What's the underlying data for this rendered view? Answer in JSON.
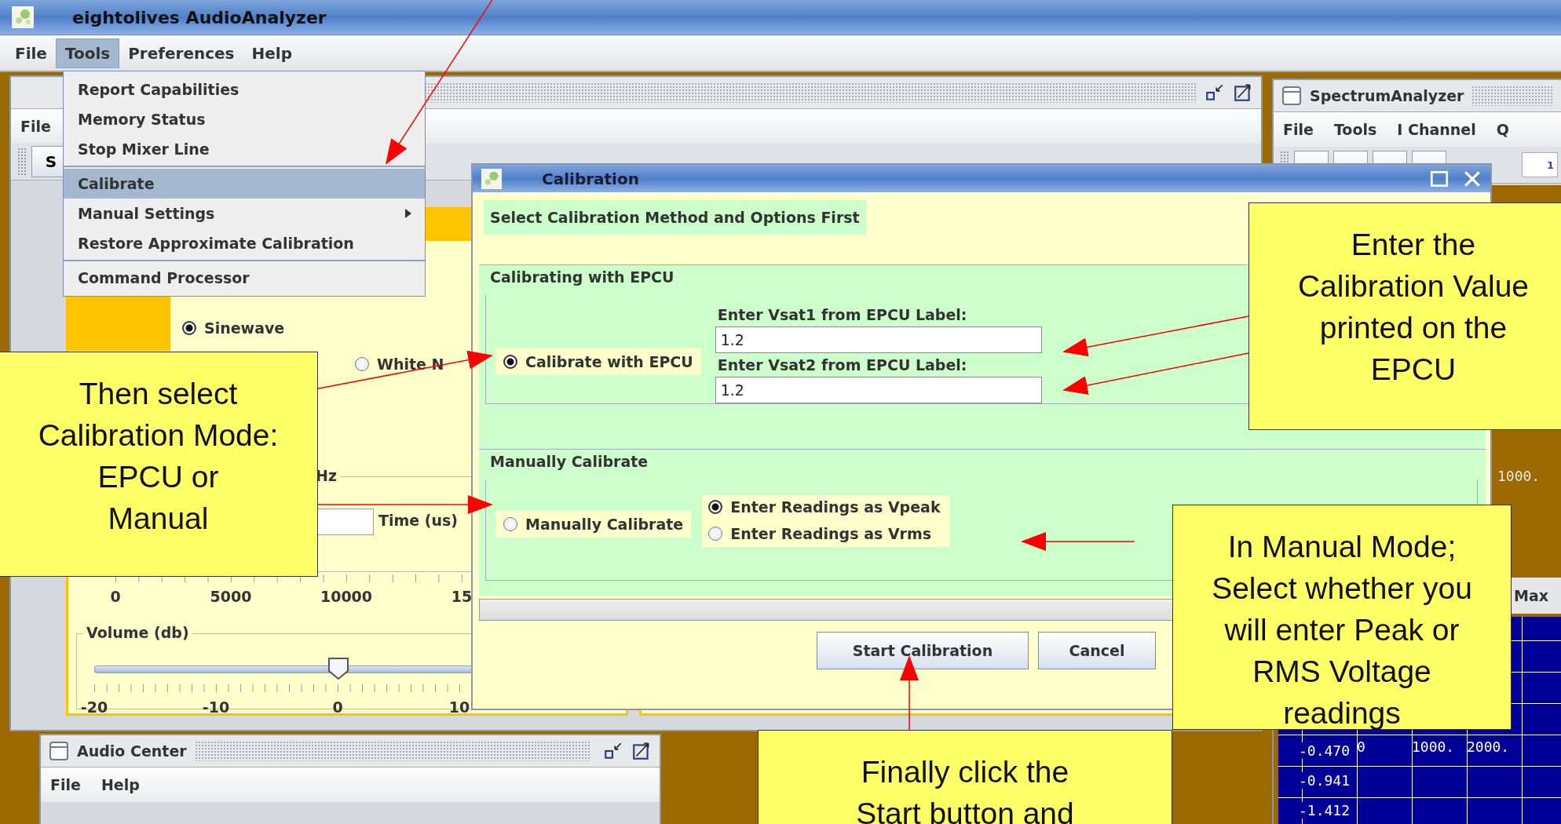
{
  "window": {
    "title": "eightolives AudioAnalyzer"
  },
  "menu_bar": [
    {
      "label": "File",
      "selected": false
    },
    {
      "label": "Tools",
      "selected": true
    },
    {
      "label": "Preferences",
      "selected": false
    },
    {
      "label": "Help",
      "selected": false
    }
  ],
  "tools_menu": {
    "groups": [
      [
        {
          "label": "Report Capabilities",
          "selected": false,
          "submenu": false
        },
        {
          "label": "Memory Status",
          "selected": false,
          "submenu": false
        },
        {
          "label": "Stop Mixer Line",
          "selected": false,
          "submenu": false
        }
      ],
      [
        {
          "label": "Calibrate",
          "selected": true,
          "submenu": false
        },
        {
          "label": "Manual Settings",
          "selected": false,
          "submenu": true
        },
        {
          "label": "Restore Approximate Calibration",
          "selected": false,
          "submenu": false
        }
      ],
      [
        {
          "label": "Command Processor",
          "selected": false,
          "submenu": false
        }
      ]
    ]
  },
  "generator_window": {
    "menu": [
      "File"
    ],
    "toolbar_button": "S",
    "waveforms": [
      {
        "label": "Sinewave",
        "selected": true
      },
      {
        "label": "White N",
        "selected": false
      }
    ],
    "frequency_unit": "Hz",
    "time_label": "Time (us)",
    "frequency_ticks": [
      "0",
      "5000",
      "10000",
      "15"
    ],
    "volume": {
      "title": "Volume (db)",
      "level": 0.5,
      "ticks": [
        "-20",
        "-10",
        "0",
        "10"
      ]
    }
  },
  "audio_center": {
    "title": "Audio Center",
    "menu": [
      "File",
      "Help"
    ]
  },
  "spectrum_analyzer": {
    "title": "SpectrumAnalyzer",
    "menu": [
      "File",
      "Tools",
      "I Channel",
      "Q"
    ],
    "toolbar_value": "1",
    "readout": "1000.",
    "column_label": "Max",
    "plot_y_labels": [
      "-0.470",
      "-0.941",
      "-1.412"
    ],
    "plot_x_labels": [
      "0",
      "1000.",
      "2000."
    ]
  },
  "calibration_dialog": {
    "title": "Calibration",
    "instruction": "Select Calibration Method and Options First",
    "epcu": {
      "title": "Calibrating with EPCU",
      "option": {
        "label": "Calibrate with EPCU",
        "selected": true
      },
      "fields": [
        {
          "label": "Enter Vsat1 from EPCU Label:",
          "value": "1.2"
        },
        {
          "label": "Enter Vsat2 from EPCU Label:",
          "value": "1.2"
        }
      ]
    },
    "manual": {
      "title": "Manually Calibrate",
      "option": {
        "label": "Manually Calibrate",
        "selected": false
      },
      "reading_modes": [
        {
          "label": "Enter Readings as Vpeak",
          "selected": true
        },
        {
          "label": "Enter Readings as Vrms",
          "selected": false
        }
      ]
    },
    "buttons": [
      "Start Calibration",
      "Cancel"
    ]
  },
  "callouts": [
    {
      "lines": [
        "Enter the",
        "Calibration Value",
        "printed on the",
        "EPCU"
      ]
    },
    {
      "lines": [
        "Then select",
        "Calibration Mode:",
        "EPCU or",
        "Manual"
      ]
    },
    {
      "lines": [
        "In Manual Mode;",
        "Select whether you",
        "will enter Peak or",
        "RMS Voltage",
        "readings"
      ]
    },
    {
      "lines": [
        "Finally click the",
        "Start button and"
      ]
    }
  ]
}
